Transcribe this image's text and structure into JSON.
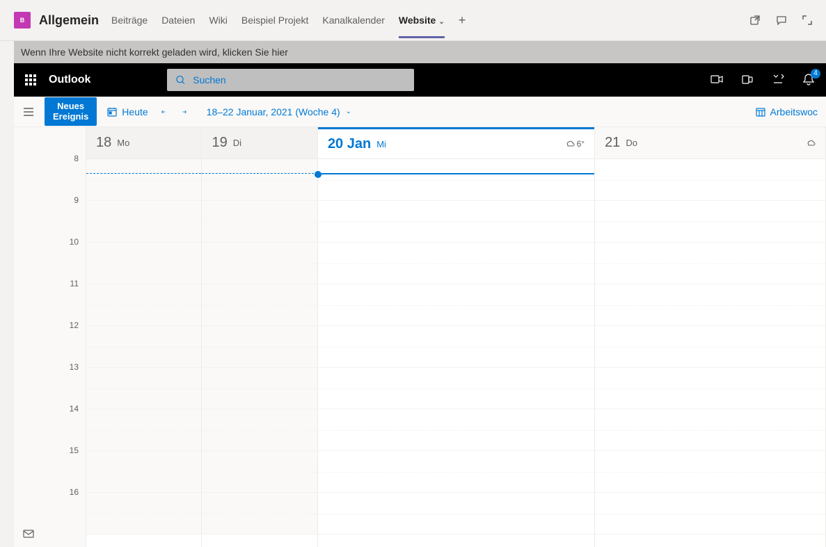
{
  "teams": {
    "badge_letter": "B",
    "channel_name": "Allgemein",
    "tabs": [
      {
        "label": "Beiträge",
        "active": false
      },
      {
        "label": "Dateien",
        "active": false
      },
      {
        "label": "Wiki",
        "active": false
      },
      {
        "label": "Beispiel Projekt",
        "active": false
      },
      {
        "label": "Kanalkalender",
        "active": false
      },
      {
        "label": "Website",
        "active": true
      }
    ]
  },
  "reload_banner": "Wenn Ihre Website nicht korrekt geladen wird, klicken Sie hier",
  "outlook": {
    "title": "Outlook",
    "search_placeholder": "Suchen",
    "notif_count": "4"
  },
  "toolbar": {
    "new_event_line1": "Neues",
    "new_event_line2": "Ereignis",
    "today": "Heute",
    "date_range": "18–22 Januar, 2021 (Woche 4)",
    "view_label": "Arbeitswoc"
  },
  "calendar": {
    "hours": [
      "8",
      "9",
      "10",
      "11",
      "12",
      "13",
      "14",
      "15",
      "16"
    ],
    "days": [
      {
        "num": "18",
        "name": "Mo",
        "today": false,
        "past": true
      },
      {
        "num": "19",
        "name": "Di",
        "today": false,
        "past": true
      },
      {
        "num": "20 Jan",
        "name": "Mi",
        "today": true,
        "past": false,
        "weather_temp": "6°"
      },
      {
        "num": "21",
        "name": "Do",
        "today": false,
        "past": false
      }
    ]
  }
}
